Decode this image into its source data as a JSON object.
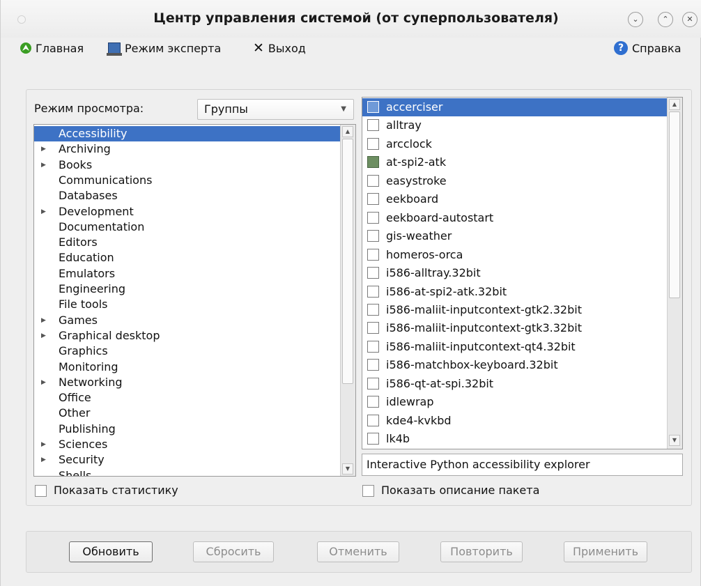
{
  "window": {
    "title": "Центр управления системой (от суперпользователя)",
    "buttons": {
      "minimize": "⌄",
      "maximize": "⌃",
      "close": "✕"
    }
  },
  "menubar": {
    "home": "Главная",
    "expert": "Режим эксперта",
    "exit": "Выход",
    "help": "Справка"
  },
  "view_mode": {
    "label": "Режим просмотра:",
    "selected": "Группы"
  },
  "groups": [
    {
      "label": "Accessibility",
      "expandable": false,
      "selected": true
    },
    {
      "label": "Archiving",
      "expandable": true
    },
    {
      "label": "Books",
      "expandable": true
    },
    {
      "label": "Communications",
      "expandable": false
    },
    {
      "label": "Databases",
      "expandable": false
    },
    {
      "label": "Development",
      "expandable": true
    },
    {
      "label": "Documentation",
      "expandable": false
    },
    {
      "label": "Editors",
      "expandable": false
    },
    {
      "label": "Education",
      "expandable": false
    },
    {
      "label": "Emulators",
      "expandable": false
    },
    {
      "label": "Engineering",
      "expandable": false
    },
    {
      "label": "File tools",
      "expandable": false
    },
    {
      "label": "Games",
      "expandable": true
    },
    {
      "label": "Graphical desktop",
      "expandable": true
    },
    {
      "label": "Graphics",
      "expandable": false
    },
    {
      "label": "Monitoring",
      "expandable": false
    },
    {
      "label": "Networking",
      "expandable": true
    },
    {
      "label": "Office",
      "expandable": false
    },
    {
      "label": "Other",
      "expandable": false
    },
    {
      "label": "Publishing",
      "expandable": false
    },
    {
      "label": "Sciences",
      "expandable": true
    },
    {
      "label": "Security",
      "expandable": true
    },
    {
      "label": "Shells",
      "expandable": false
    }
  ],
  "packages": [
    {
      "name": "accerciser",
      "installed": false,
      "selected": true
    },
    {
      "name": "alltray",
      "installed": false
    },
    {
      "name": "arcclock",
      "installed": false
    },
    {
      "name": "at-spi2-atk",
      "installed": true
    },
    {
      "name": "easystroke",
      "installed": false
    },
    {
      "name": "eekboard",
      "installed": false
    },
    {
      "name": "eekboard-autostart",
      "installed": false
    },
    {
      "name": "gis-weather",
      "installed": false
    },
    {
      "name": "homeros-orca",
      "installed": false
    },
    {
      "name": "i586-alltray.32bit",
      "installed": false
    },
    {
      "name": "i586-at-spi2-atk.32bit",
      "installed": false
    },
    {
      "name": "i586-maliit-inputcontext-gtk2.32bit",
      "installed": false
    },
    {
      "name": "i586-maliit-inputcontext-gtk3.32bit",
      "installed": false
    },
    {
      "name": "i586-maliit-inputcontext-qt4.32bit",
      "installed": false
    },
    {
      "name": "i586-matchbox-keyboard.32bit",
      "installed": false
    },
    {
      "name": "i586-qt-at-spi.32bit",
      "installed": false
    },
    {
      "name": "idlewrap",
      "installed": false
    },
    {
      "name": "kde4-kvkbd",
      "installed": false
    },
    {
      "name": "lk4b",
      "installed": false
    }
  ],
  "description": "Interactive Python accessibility explorer",
  "show_stats": {
    "label": "Показать статистику",
    "checked": false
  },
  "show_description": {
    "label": "Показать описание пакета",
    "checked": false
  },
  "buttons": {
    "refresh": "Обновить",
    "reset": "Сбросить",
    "cancel": "Отменить",
    "redo": "Повторить",
    "apply": "Применить"
  }
}
